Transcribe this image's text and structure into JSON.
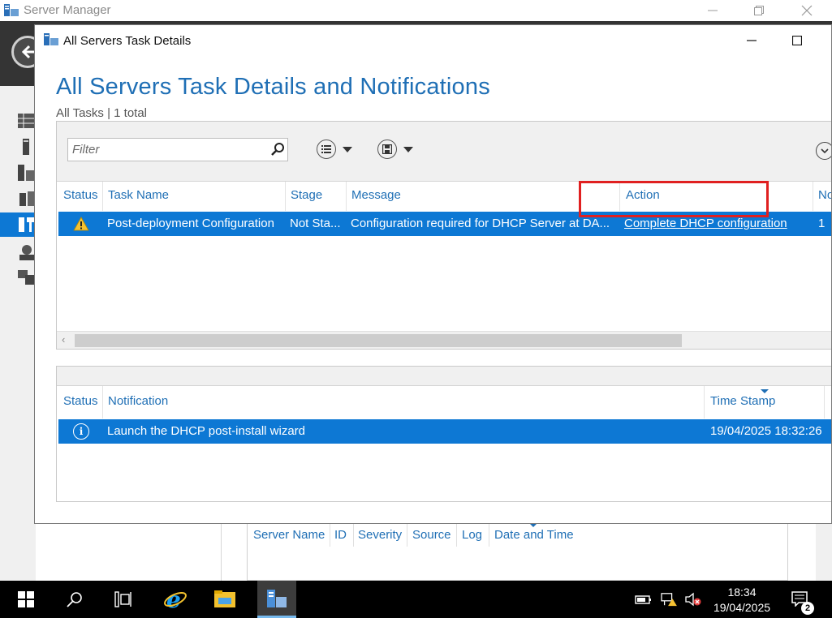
{
  "server_manager": {
    "title": "Server Manager",
    "event_columns": [
      "Server Name",
      "ID",
      "Severity",
      "Source",
      "Log",
      "Date and Time"
    ]
  },
  "dialog": {
    "title": "All Servers Task Details",
    "heading": "All Servers Task Details and Notifications",
    "subheading": "All Tasks | 1 total",
    "filter_placeholder": "Filter",
    "tasks": {
      "columns": [
        "Status",
        "Task Name",
        "Stage",
        "Message",
        "Action",
        "No"
      ],
      "rows": [
        {
          "status_icon": "warning-icon",
          "task_name": "Post-deployment Configuration",
          "stage": "Not Sta...",
          "message": "Configuration required for DHCP Server at DA...",
          "action": "Complete DHCP configuration",
          "notifications": "1"
        }
      ]
    },
    "notifications": {
      "columns": [
        "Status",
        "Notification",
        "Time Stamp"
      ],
      "rows": [
        {
          "status_icon": "info-icon",
          "notification": "Launch the DHCP post-install wizard",
          "timestamp": "19/04/2025 18:32:26"
        }
      ]
    }
  },
  "taskbar": {
    "time": "18:34",
    "date": "19/04/2025",
    "notification_count": "2"
  },
  "colors": {
    "selection": "#0d78d4",
    "heading": "#1f6fb5",
    "highlight": "#e02020"
  }
}
